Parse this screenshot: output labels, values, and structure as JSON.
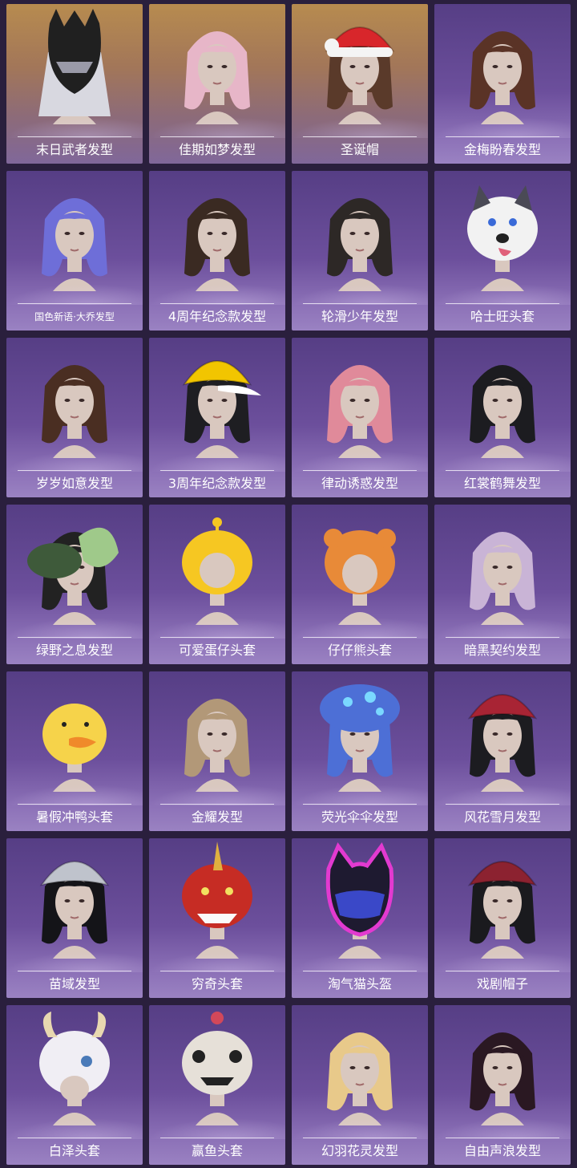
{
  "items": [
    {
      "name": "末日武者发型",
      "icon": "armored-helmet-hair",
      "bg": "gold",
      "accent": "#202020",
      "hair": "#d8d8e0"
    },
    {
      "name": "佳期如梦发型",
      "icon": "long-pink-hair",
      "bg": "gold",
      "accent": "#e7b6c8",
      "hair": "#e7b6c8"
    },
    {
      "name": "圣诞帽",
      "icon": "santa-hat",
      "bg": "gold",
      "accent": "#d8262b",
      "hair": "#5a3a2a"
    },
    {
      "name": "金梅盼春发型",
      "icon": "short-brown-hair",
      "bg": "purple",
      "accent": "#5a3326",
      "hair": "#5a3326"
    },
    {
      "name": "国色新语·大乔发型",
      "icon": "purple-braid-hair",
      "bg": "purple",
      "accent": "#6e6ed8",
      "hair": "#6e6ed8"
    },
    {
      "name": "4周年纪念款发型",
      "icon": "wavy-brown-hair",
      "bg": "purple",
      "accent": "#3a2a22",
      "hair": "#3a2a22"
    },
    {
      "name": "轮滑少年发型",
      "icon": "ponytail-hair",
      "bg": "purple",
      "accent": "#2d2826",
      "hair": "#2d2826"
    },
    {
      "name": "哈士旺头套",
      "icon": "husky-head",
      "bg": "purple",
      "accent": "#f2f2f2",
      "hair": "#4a4a55"
    },
    {
      "name": "岁岁如意发型",
      "icon": "side-ponytail-hair",
      "bg": "purple",
      "accent": "#c8182a",
      "hair": "#4a2e22"
    },
    {
      "name": "3周年纪念款发型",
      "icon": "baseball-cap",
      "bg": "purple",
      "accent": "#f2c500",
      "hair": "#1e1e22"
    },
    {
      "name": "律动诱惑发型",
      "icon": "pink-twintail-hair",
      "bg": "purple",
      "accent": "#e08a9a",
      "hair": "#e08a9a"
    },
    {
      "name": "红裳鹤舞发型",
      "icon": "double-bun-hair",
      "bg": "purple",
      "accent": "#1c1c20",
      "hair": "#1c1c20"
    },
    {
      "name": "绿野之息发型",
      "icon": "butterfly-hat",
      "bg": "purple",
      "accent": "#9fc98a",
      "hair": "#222222"
    },
    {
      "name": "可爱蛋仔头套",
      "icon": "egg-party-head",
      "bg": "purple",
      "accent": "#f6c722",
      "hair": "#f6c722"
    },
    {
      "name": "仔仔熊头套",
      "icon": "bear-head",
      "bg": "purple",
      "accent": "#e88a38",
      "hair": "#e88a38"
    },
    {
      "name": "暗黑契约发型",
      "icon": "lavender-hair",
      "bg": "purple",
      "accent": "#c9b4d6",
      "hair": "#c9b4d6"
    },
    {
      "name": "暑假冲鸭头套",
      "icon": "duck-head",
      "bg": "purple",
      "accent": "#f6d34a",
      "hair": "#f6d34a"
    },
    {
      "name": "金耀发型",
      "icon": "blonde-long-hair",
      "bg": "purple",
      "accent": "#b29878",
      "hair": "#b29878"
    },
    {
      "name": "荧光伞伞发型",
      "icon": "mushroom-hat",
      "bg": "purple",
      "accent": "#4d6fd6",
      "hair": "#4d6fd6"
    },
    {
      "name": "风花雪月发型",
      "icon": "embroidered-hat",
      "bg": "purple",
      "accent": "#a82434",
      "hair": "#1c1c20"
    },
    {
      "name": "苗域发型",
      "icon": "silver-headdress",
      "bg": "purple",
      "accent": "#bfc3cc",
      "hair": "#141418"
    },
    {
      "name": "穷奇头套",
      "icon": "dragon-mask",
      "bg": "purple",
      "accent": "#c62c24",
      "hair": "#2a2018"
    },
    {
      "name": "淘气猫头盔",
      "icon": "cat-helmet",
      "bg": "purple",
      "accent": "#e23ad0",
      "hair": "#1e1a30"
    },
    {
      "name": "戏剧帽子",
      "icon": "jester-hat",
      "bg": "purple",
      "accent": "#8c2230",
      "hair": "#1a1a1e"
    },
    {
      "name": "白泽头套",
      "icon": "white-beast-mask",
      "bg": "purple",
      "accent": "#f0eef4",
      "hair": "#c23a2a"
    },
    {
      "name": "赢鱼头套",
      "icon": "fish-mask",
      "bg": "purple",
      "accent": "#e6e0d8",
      "hair": "#d2485a"
    },
    {
      "name": "幻羽花灵发型",
      "icon": "blonde-braid-hair",
      "bg": "purple",
      "accent": "#e8c98a",
      "hair": "#e8c98a"
    },
    {
      "name": "自由声浪发型",
      "icon": "magenta-long-hair",
      "bg": "purple",
      "accent": "#c2306a",
      "hair": "#2a1822"
    }
  ]
}
